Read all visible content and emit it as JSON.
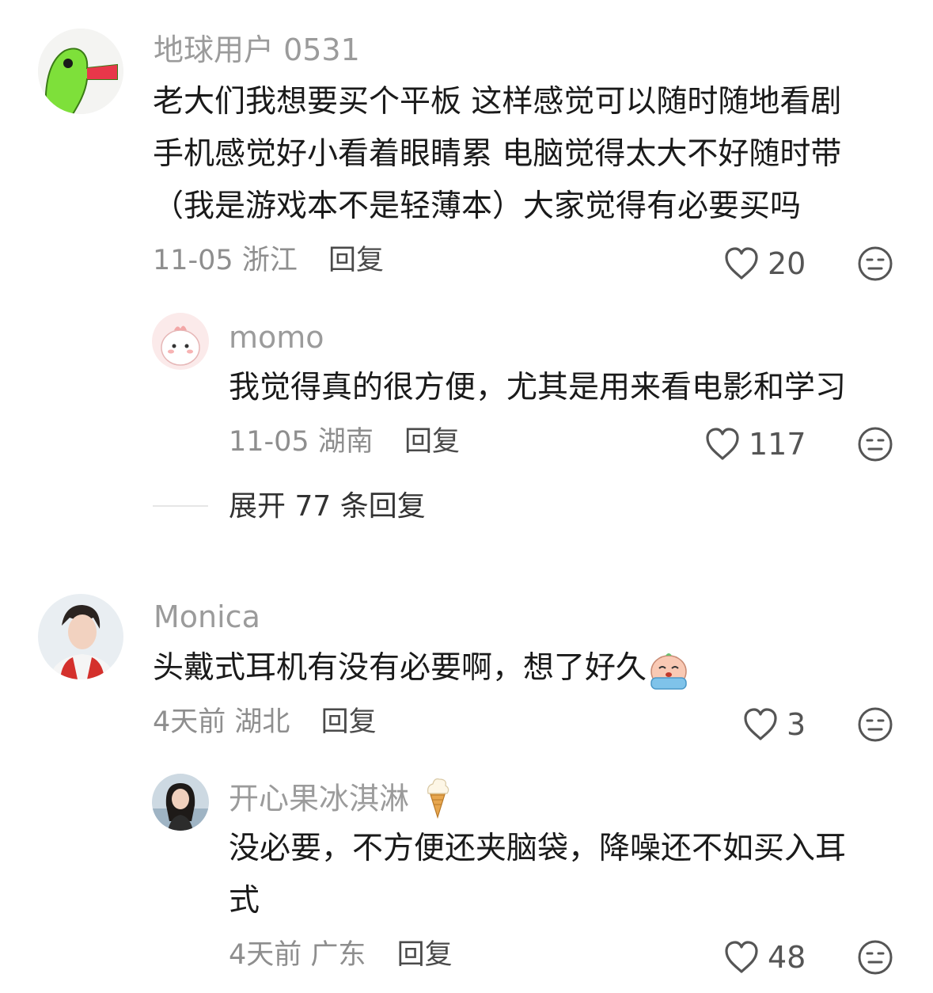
{
  "comments": [
    {
      "username": "地球用户 0531",
      "lines": [
        "老大们我想要买个平板 这样感觉可以随时随地看剧",
        "手机感觉好小看着眼睛累 电脑觉得太大不好随时带",
        "（我是游戏本不是轻薄本）大家觉得有必要买吗"
      ],
      "date": "11-05",
      "location": "浙江",
      "reply_label": "回复",
      "likes": "20",
      "reply": {
        "username": "momo",
        "lines": [
          "我觉得真的很方便，尤其是用来看电影和学习"
        ],
        "date": "11-05",
        "location": "湖南",
        "reply_label": "回复",
        "likes": "117"
      },
      "expand_label": "展开 77 条回复"
    },
    {
      "username": "Monica",
      "lines": [
        "头戴式耳机有没有必要啊，想了好久"
      ],
      "date": "4天前",
      "location": "湖北",
      "reply_label": "回复",
      "likes": "3",
      "reply": {
        "username": "开心果冰淇淋",
        "lines": [
          "没必要，不方便还夹脑袋，降噪还不如买入耳",
          "式"
        ],
        "date": "4天前",
        "location": "广东",
        "reply_label": "回复",
        "likes": "48"
      }
    }
  ],
  "icons": {
    "like": "heart-outline-icon",
    "face": "meh-face-icon",
    "crying_emoji": "crying-emoji-icon",
    "ice_cream": "ice-cream-icon"
  },
  "colors": {
    "username": "#9b9b9b",
    "text": "#1a1a1a",
    "meta": "#8e8e8e"
  }
}
